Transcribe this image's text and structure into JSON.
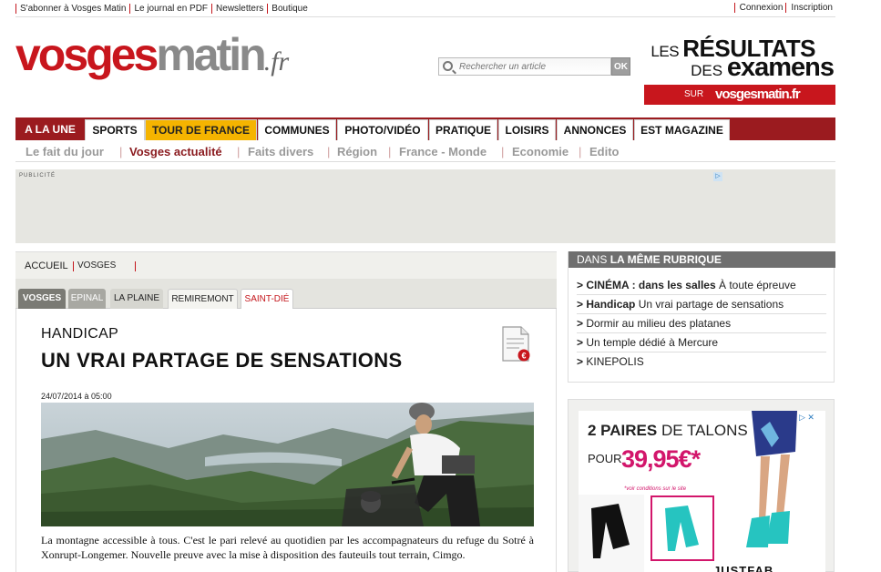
{
  "topbar": {
    "left_links": [
      "S'abonner à Vosges Matin",
      "Le journal en PDF",
      "Newsletters",
      "Boutique"
    ],
    "right_links": [
      "Connexion",
      "Inscription"
    ]
  },
  "logo": {
    "part1": "vosges",
    "part2": "matin",
    "part3": ".fr"
  },
  "search": {
    "placeholder": "Rechercher un article",
    "ok_label": "OK"
  },
  "promo": {
    "line1_small": "LES ",
    "line1_big": "RÉSULTATS",
    "line2_small": "DES ",
    "line2_big": "examens",
    "band_sur": "SUR",
    "band_logo": "vosgesmatin.fr"
  },
  "nav": {
    "tabs": [
      "A LA UNE",
      "SPORTS",
      "TOUR DE FRANCE",
      "COMMUNES",
      "PHOTO/VIDÉO",
      "PRATIQUE",
      "LOISIRS",
      "ANNONCES",
      "EST MAGAZINE"
    ],
    "subtabs": [
      "Le fait du jour",
      "Vosges actualité",
      "Faits divers",
      "Région",
      "France - Monde",
      "Economie",
      "Edito"
    ]
  },
  "ad": {
    "label": "PUBLICITÉ"
  },
  "breadcrumb": {
    "home": "ACCUEIL",
    "section": "VOSGES"
  },
  "local_tabs": [
    "VOSGES",
    "EPINAL",
    "LA PLAINE",
    "REMIREMONT",
    "SAINT-DIÉ"
  ],
  "article": {
    "kicker": "HANDICAP",
    "title": "UN VRAI PARTAGE DE SENSATIONS",
    "date": "24/07/2014 à 05:00",
    "lead": "La montagne accessible à tous. C'est le pari relevé au quotidien par les accompagnateurs du refuge du Sotré à Xonrupt-Longemer. Nouvelle preuve avec la mise à disposition des fauteuils tout terrain, Cimgo."
  },
  "rubrique": {
    "head_prefix": "DANS ",
    "head_bold": "LA MÊME RUBRIQUE",
    "items": [
      {
        "bold": "CINÉMA : dans les salles",
        "rest": " À toute épreuve"
      },
      {
        "bold": "Handicap",
        "rest": " Un vrai partage de sensations"
      },
      {
        "bold": "",
        "rest": " Dormir au milieu des platanes"
      },
      {
        "bold": "",
        "rest": " Un temple dédié à Mercure"
      },
      {
        "bold": "",
        "rest": " KINEPOLIS"
      }
    ],
    "arrow": ">"
  },
  "side_ad": {
    "line1_a": "2 PAIRES ",
    "line1_b": "DE TALONS",
    "pour": "POUR",
    "price": "39,95€*",
    "note": "*voir conditions sur le site",
    "brand": "JUSTFAB"
  },
  "colors": {
    "brand_red": "#c8161d",
    "nav_red": "#9b1b1f",
    "tdf_yellow": "#f5b400"
  }
}
